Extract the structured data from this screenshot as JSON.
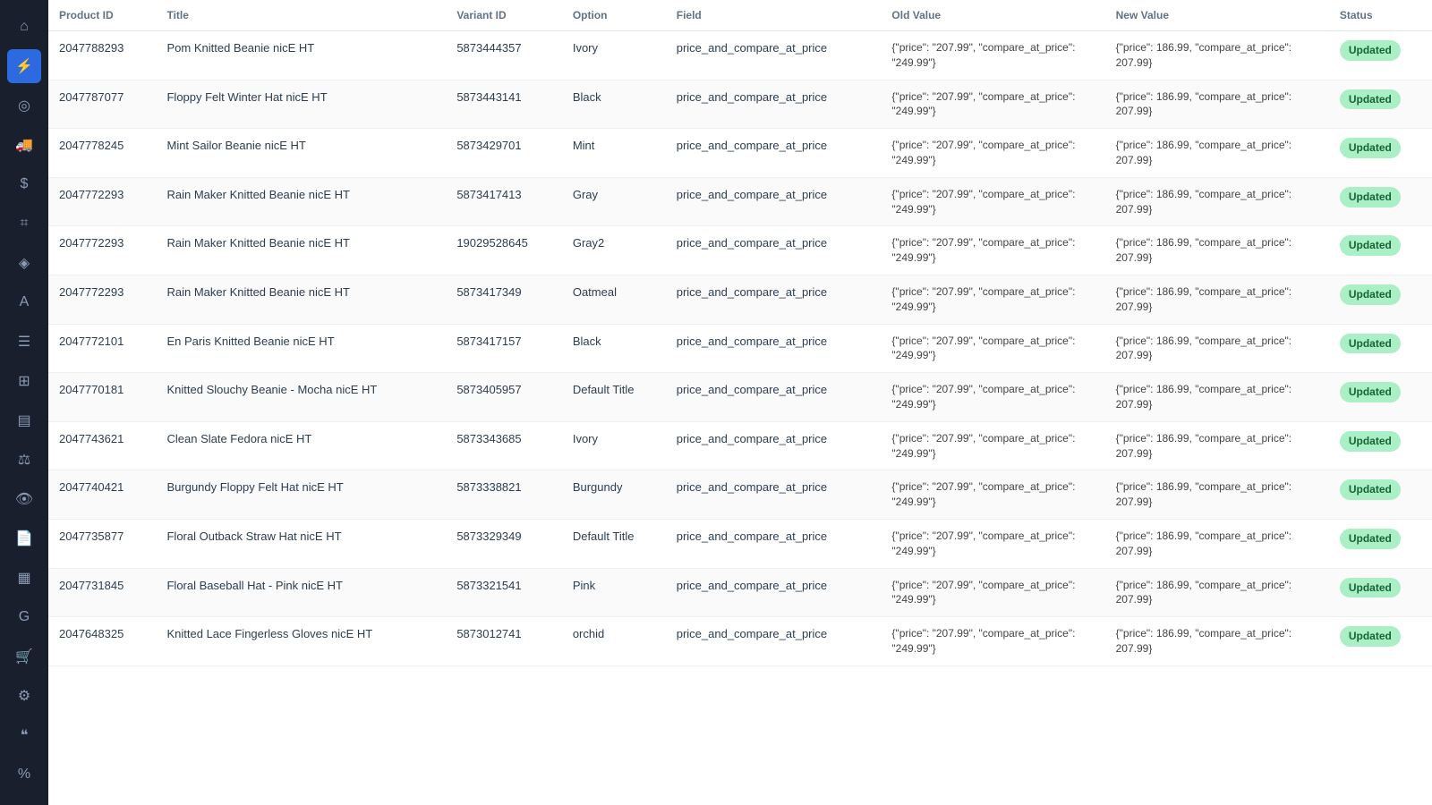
{
  "sidebar": {
    "icons": [
      {
        "name": "home-icon",
        "symbol": "⌂",
        "active": false
      },
      {
        "name": "lightning-icon",
        "symbol": "⚡",
        "active": true
      },
      {
        "name": "analytics-icon",
        "symbol": "◎",
        "active": false
      },
      {
        "name": "shipping-icon",
        "symbol": "🚚",
        "active": false
      },
      {
        "name": "dollar-icon",
        "symbol": "$",
        "active": false
      },
      {
        "name": "tag-price-icon",
        "symbol": "⌗",
        "active": false
      },
      {
        "name": "tag-icon",
        "symbol": "◈",
        "active": false
      },
      {
        "name": "text-icon",
        "symbol": "A",
        "active": false
      },
      {
        "name": "list-icon",
        "symbol": "☰",
        "active": false
      },
      {
        "name": "grid-icon",
        "symbol": "⊞",
        "active": false
      },
      {
        "name": "table-icon",
        "symbol": "▤",
        "active": false
      },
      {
        "name": "scale-icon",
        "symbol": "⚖",
        "active": false
      },
      {
        "name": "eye-icon",
        "symbol": "👁",
        "active": false
      },
      {
        "name": "doc-icon",
        "symbol": "📄",
        "active": false
      },
      {
        "name": "barcode-icon",
        "symbol": "▦",
        "active": false
      },
      {
        "name": "g-icon",
        "symbol": "G",
        "active": false
      },
      {
        "name": "cart-icon",
        "symbol": "🛒",
        "active": false
      },
      {
        "name": "puzzle-icon",
        "symbol": "⚙",
        "active": false
      },
      {
        "name": "quote-icon",
        "symbol": "❝",
        "active": false
      },
      {
        "name": "percent-icon",
        "symbol": "%",
        "active": false
      }
    ]
  },
  "table": {
    "columns": [
      "Product ID",
      "Title",
      "Variant ID",
      "Option",
      "Field",
      "Old Value",
      "New Value",
      "Status"
    ],
    "rows": [
      {
        "product_id": "2047788293",
        "title": "Pom Knitted Beanie nicE HT",
        "variant_id": "5873444357",
        "option": "Ivory",
        "field": "price_and_compare_at_price",
        "old_value": "{\"price\": \"207.99\", \"compare_at_price\": \"249.99\"}",
        "new_value": "{\"price\": 186.99, \"compare_at_price\": 207.99}",
        "status": "Updated"
      },
      {
        "product_id": "2047787077",
        "title": "Floppy Felt Winter Hat nicE HT",
        "variant_id": "5873443141",
        "option": "Black",
        "field": "price_and_compare_at_price",
        "old_value": "{\"price\": \"207.99\", \"compare_at_price\": \"249.99\"}",
        "new_value": "{\"price\": 186.99, \"compare_at_price\": 207.99}",
        "status": "Updated"
      },
      {
        "product_id": "2047778245",
        "title": "Mint Sailor Beanie nicE HT",
        "variant_id": "5873429701",
        "option": "Mint",
        "field": "price_and_compare_at_price",
        "old_value": "{\"price\": \"207.99\", \"compare_at_price\": \"249.99\"}",
        "new_value": "{\"price\": 186.99, \"compare_at_price\": 207.99}",
        "status": "Updated"
      },
      {
        "product_id": "2047772293",
        "title": "Rain Maker Knitted Beanie nicE HT",
        "variant_id": "5873417413",
        "option": "Gray",
        "field": "price_and_compare_at_price",
        "old_value": "{\"price\": \"207.99\", \"compare_at_price\": \"249.99\"}",
        "new_value": "{\"price\": 186.99, \"compare_at_price\": 207.99}",
        "status": "Updated"
      },
      {
        "product_id": "2047772293",
        "title": "Rain Maker Knitted Beanie nicE HT",
        "variant_id": "19029528645",
        "option": "Gray2",
        "field": "price_and_compare_at_price",
        "old_value": "{\"price\": \"207.99\", \"compare_at_price\": \"249.99\"}",
        "new_value": "{\"price\": 186.99, \"compare_at_price\": 207.99}",
        "status": "Updated"
      },
      {
        "product_id": "2047772293",
        "title": "Rain Maker Knitted Beanie nicE HT",
        "variant_id": "5873417349",
        "option": "Oatmeal",
        "field": "price_and_compare_at_price",
        "old_value": "{\"price\": \"207.99\", \"compare_at_price\": \"249.99\"}",
        "new_value": "{\"price\": 186.99, \"compare_at_price\": 207.99}",
        "status": "Updated"
      },
      {
        "product_id": "2047772101",
        "title": "En Paris Knitted Beanie nicE HT",
        "variant_id": "5873417157",
        "option": "Black",
        "field": "price_and_compare_at_price",
        "old_value": "{\"price\": \"207.99\", \"compare_at_price\": \"249.99\"}",
        "new_value": "{\"price\": 186.99, \"compare_at_price\": 207.99}",
        "status": "Updated"
      },
      {
        "product_id": "2047770181",
        "title": "Knitted Slouchy Beanie - Mocha nicE HT",
        "variant_id": "5873405957",
        "option": "Default Title",
        "field": "price_and_compare_at_price",
        "old_value": "{\"price\": \"207.99\", \"compare_at_price\": \"249.99\"}",
        "new_value": "{\"price\": 186.99, \"compare_at_price\": 207.99}",
        "status": "Updated"
      },
      {
        "product_id": "2047743621",
        "title": "Clean Slate Fedora nicE HT",
        "variant_id": "5873343685",
        "option": "Ivory",
        "field": "price_and_compare_at_price",
        "old_value": "{\"price\": \"207.99\", \"compare_at_price\": \"249.99\"}",
        "new_value": "{\"price\": 186.99, \"compare_at_price\": 207.99}",
        "status": "Updated"
      },
      {
        "product_id": "2047740421",
        "title": "Burgundy Floppy Felt Hat nicE HT",
        "variant_id": "5873338821",
        "option": "Burgundy",
        "field": "price_and_compare_at_price",
        "old_value": "{\"price\": \"207.99\", \"compare_at_price\": \"249.99\"}",
        "new_value": "{\"price\": 186.99, \"compare_at_price\": 207.99}",
        "status": "Updated"
      },
      {
        "product_id": "2047735877",
        "title": "Floral Outback Straw Hat nicE HT",
        "variant_id": "5873329349",
        "option": "Default Title",
        "field": "price_and_compare_at_price",
        "old_value": "{\"price\": \"207.99\", \"compare_at_price\": \"249.99\"}",
        "new_value": "{\"price\": 186.99, \"compare_at_price\": 207.99}",
        "status": "Updated"
      },
      {
        "product_id": "2047731845",
        "title": "Floral Baseball Hat - Pink nicE HT",
        "variant_id": "5873321541",
        "option": "Pink",
        "field": "price_and_compare_at_price",
        "old_value": "{\"price\": \"207.99\", \"compare_at_price\": \"249.99\"}",
        "new_value": "{\"price\": 186.99, \"compare_at_price\": 207.99}",
        "status": "Updated"
      },
      {
        "product_id": "2047648325",
        "title": "Knitted Lace Fingerless Gloves nicE HT",
        "variant_id": "5873012741",
        "option": "orchid",
        "field": "price_and_compare_at_price",
        "old_value": "{\"price\": \"207.99\", \"compare_at_price\": \"249.99\"}",
        "new_value": "{\"price\": 186.99, \"compare_at_price\": 207.99}",
        "status": "Updated"
      }
    ]
  }
}
